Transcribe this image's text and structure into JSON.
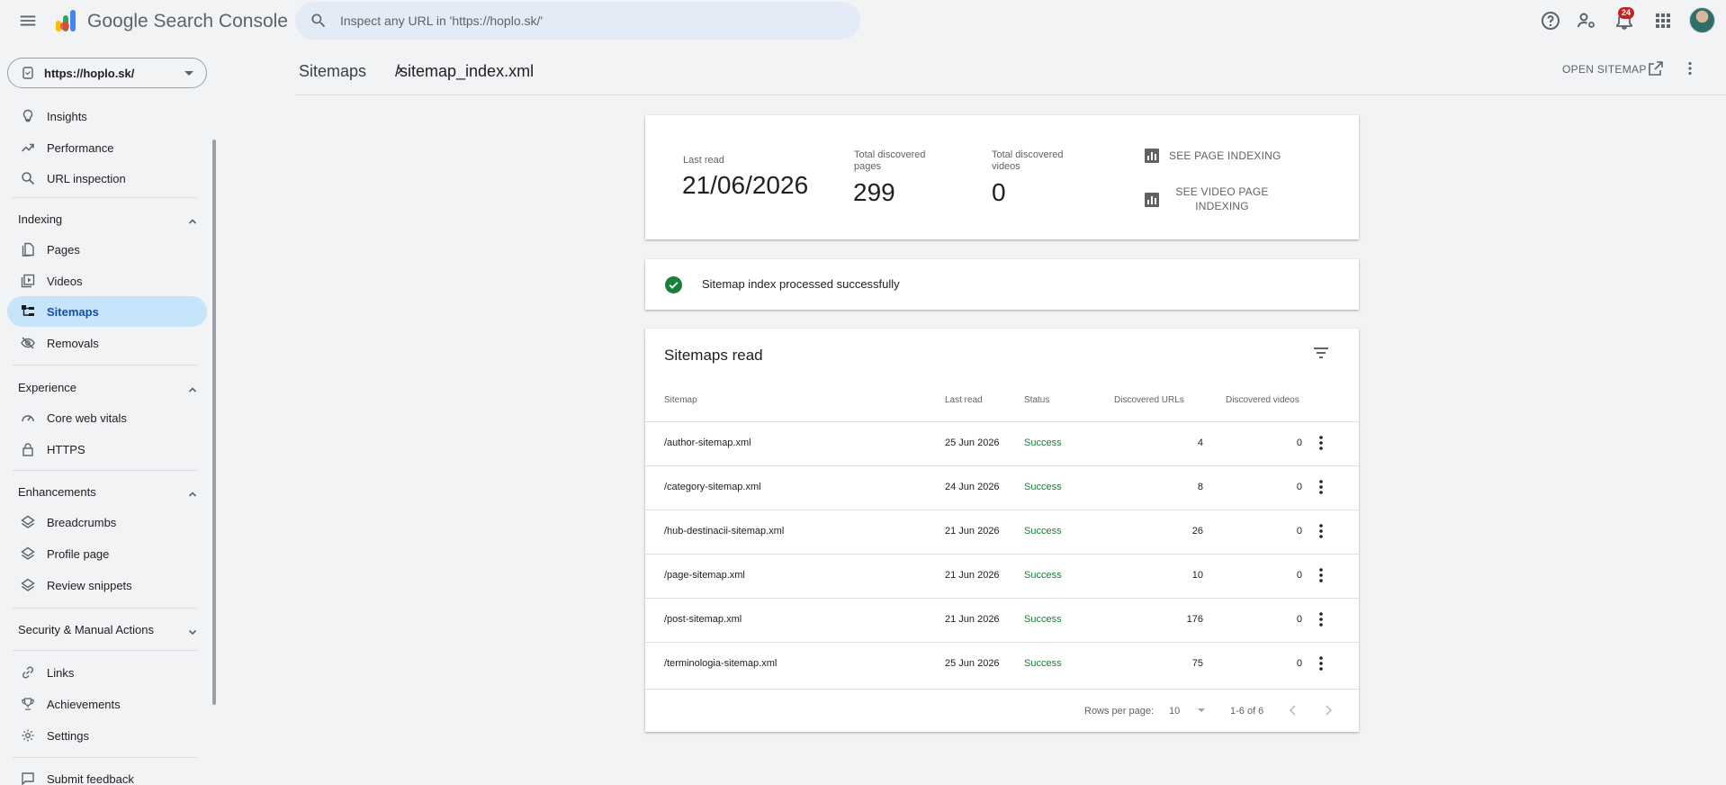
{
  "app": {
    "brand": "Google Search Console",
    "search_placeholder": "Inspect any URL in 'https://hoplo.sk/'",
    "notification_count": "24"
  },
  "sidebar": {
    "property": "https://hoplo.sk/",
    "top_items": [
      {
        "label": "Insights",
        "icon": "lightbulb-icon"
      },
      {
        "label": "Performance",
        "icon": "trending-up-icon"
      },
      {
        "label": "URL inspection",
        "icon": "search-icon"
      }
    ],
    "sections": {
      "indexing": "Indexing",
      "experience": "Experience",
      "enhancements": "Enhancements",
      "security": "Security & Manual Actions"
    },
    "indexing_items": [
      {
        "label": "Pages",
        "icon": "pages-icon"
      },
      {
        "label": "Videos",
        "icon": "video-library-icon"
      },
      {
        "label": "Sitemaps",
        "icon": "sitemap-icon",
        "active": true
      },
      {
        "label": "Removals",
        "icon": "eye-off-icon"
      }
    ],
    "experience_items": [
      {
        "label": "Core web vitals",
        "icon": "speed-icon"
      },
      {
        "label": "HTTPS",
        "icon": "lock-icon"
      }
    ],
    "enhancement_items": [
      {
        "label": "Breadcrumbs",
        "icon": "layers-icon"
      },
      {
        "label": "Profile page",
        "icon": "layers-icon"
      },
      {
        "label": "Review snippets",
        "icon": "layers-icon"
      }
    ],
    "bottom_items": [
      {
        "label": "Links",
        "icon": "link-icon"
      },
      {
        "label": "Achievements",
        "icon": "trophy-icon"
      },
      {
        "label": "Settings",
        "icon": "gear-icon"
      }
    ],
    "feedback": "Submit feedback"
  },
  "header": {
    "crumb_root": "Sitemaps",
    "crumb_current": "/sitemap_index.xml",
    "open_sitemap": "OPEN SITEMAP"
  },
  "summary": {
    "last_read_label": "Last read",
    "last_read_value": "21/06/2026",
    "pages_label": "Total discovered pages",
    "pages_value": "299",
    "videos_label": "Total discovered videos",
    "videos_value": "0",
    "see_page_indexing": "SEE PAGE INDEXING",
    "see_video_indexing": "SEE VIDEO PAGE INDEXING"
  },
  "status": {
    "message": "Sitemap index processed successfully"
  },
  "table": {
    "title": "Sitemaps read",
    "columns": {
      "sitemap": "Sitemap",
      "last_read": "Last read",
      "status": "Status",
      "urls": "Discovered URLs",
      "videos": "Discovered videos"
    },
    "rows": [
      {
        "sitemap": "/author-sitemap.xml",
        "last_read": "25 Jun 2026",
        "status": "Success",
        "urls": "4",
        "videos": "0"
      },
      {
        "sitemap": "/category-sitemap.xml",
        "last_read": "24 Jun 2026",
        "status": "Success",
        "urls": "8",
        "videos": "0"
      },
      {
        "sitemap": "/hub-destinacii-sitemap.xml",
        "last_read": "21 Jun 2026",
        "status": "Success",
        "urls": "26",
        "videos": "0"
      },
      {
        "sitemap": "/page-sitemap.xml",
        "last_read": "21 Jun 2026",
        "status": "Success",
        "urls": "10",
        "videos": "0"
      },
      {
        "sitemap": "/post-sitemap.xml",
        "last_read": "21 Jun 2026",
        "status": "Success",
        "urls": "176",
        "videos": "0"
      },
      {
        "sitemap": "/terminologia-sitemap.xml",
        "last_read": "25 Jun 2026",
        "status": "Success",
        "urls": "75",
        "videos": "0"
      }
    ],
    "footer": {
      "rows_per_page_label": "Rows per page:",
      "rows_per_page_value": "10",
      "range": "1-6 of 6"
    }
  },
  "colors": {
    "accent": "#1a73e8",
    "success": "#188038",
    "active_nav_bg": "#c6e4fa",
    "badge": "#c5221f"
  }
}
